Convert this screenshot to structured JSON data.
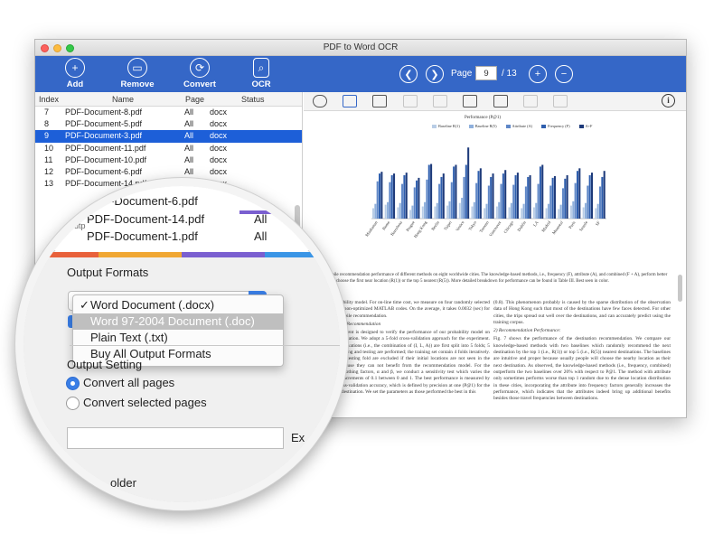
{
  "app": {
    "title": "PDF to Word OCR"
  },
  "toolbar": {
    "buttons": [
      {
        "label": "Add",
        "icon": "add-icon"
      },
      {
        "label": "Remove",
        "icon": "remove-icon"
      },
      {
        "label": "Convert",
        "icon": "convert-icon"
      },
      {
        "label": "OCR",
        "icon": "ocr-icon"
      }
    ],
    "nav": {
      "page_label": "Page",
      "current_page": "9",
      "total": "/ 13"
    }
  },
  "file_table": {
    "headers": [
      "Index",
      "Name",
      "Page",
      "Status"
    ],
    "rows": [
      {
        "index": "7",
        "name": "PDF-Document-8.pdf",
        "page": "All",
        "status": "docx"
      },
      {
        "index": "8",
        "name": "PDF-Document-5.pdf",
        "page": "All",
        "status": "docx"
      },
      {
        "index": "9",
        "name": "PDF-Document-3.pdf",
        "page": "All",
        "status": "docx"
      },
      {
        "index": "10",
        "name": "PDF-Document-11.pdf",
        "page": "All",
        "status": "docx"
      },
      {
        "index": "11",
        "name": "PDF-Document-10.pdf",
        "page": "All",
        "status": "docx"
      },
      {
        "index": "12",
        "name": "PDF-Document-6.pdf",
        "page": "All",
        "status": "docx"
      },
      {
        "index": "13",
        "name": "PDF-Document-14.pdf",
        "page": "All",
        "status": "docx"
      }
    ],
    "selected_index": "9"
  },
  "magnifier": {
    "rows": [
      {
        "name": "PDF-Document-6.pdf",
        "page": ""
      },
      {
        "name": "PDF-Document-14.pdf",
        "page": "All"
      },
      {
        "name": "PDF-Document-1.pdf",
        "page": "All"
      }
    ],
    "tab_fragment": "Outp",
    "output_formats_title": "Output Formats",
    "format_options": [
      {
        "label": "Word Document (.docx)",
        "checked": true
      },
      {
        "label": "Word 97-2004 Document (.doc)",
        "checked": false
      },
      {
        "label": "Plain Text (.txt)",
        "checked": false
      },
      {
        "label": "Buy All Output Formats",
        "checked": false
      }
    ],
    "output_setting_title": "Output Setting",
    "convert_all": "Convert all pages",
    "convert_selected": "Convert selected pages",
    "ex_fragment": "Ex",
    "folder_fragment": "older"
  },
  "document": {
    "chart_title": "Performance (P@1)",
    "legend": [
      "Baseline R(1)",
      "Baseline R(5)",
      "Attribute (A)",
      "Frequency (F)",
      "A+F"
    ],
    "figure_caption": "Fig. 7.   Mobile recommendation performance of different methods on eight worldwide cities. The knowledge-based methods, i.e., frequency (F), attribute (A), and combined (F + A), perform better than naively choose the first near location (R(1)) or the top 5 nearest (R(5)). More detailed breakdown for performance can be found in Table III. Best seen in color.",
    "col1_p1": "Bayesian probability model. For on-line time cost, we measure on four randomly selected cities using the non-optimized MATLAB codes. On the average, it takes 0.0032 (sec) for personalized mobile recommendation.",
    "col1_head": "A.  Mobile Travel Recommendation",
    "col1_p2": "The first experiment is designed to verify the performance of our probability model on travel recommendation. We adopt a 5-fold cross-validation approach for the experiment. That is, the observations (i.e., the combination of (I, L, A)) are first split into 5 folds; 5 iterations of training and testing are performed; the training set contain 4 folds iteratively. Instances in the testing fold are excluded if their initial locations are not seen in the training set because they can not benefit from the recommendation model. For the background smoothing factors, α and β, we conduct a sensitivity test which varies the parameters by increments of 0.1 between 0 and 1. The best performance is measured by the average cross-validation accuracy, which is defined by precision at one (P@1) for the recommended destination. We set the parameters as those performed the best in this",
    "col2_p1": "(0.8). This phenomenon probably is caused by the sparse distribution of the observation data of Hong Kong such that most of the destinations have few faces detected. For other cities, the trips spread out well over the destinations, and can accurately predict using the training corpus.",
    "col2_head": "2)  Recommendation Performance:",
    "col2_p2": "Fig. 7 shows the performance of the destination recommendation. We compare our knowledge-based methods with two baselines which randomly recommend the next destination by the top 1 (i.e., R(1)) or top 5 (i.e., R(5)) nearest destinations. The baselines are intuitive and proper because usually people will choose the nearby location as their next destination. As observed, the knowledge-based methods (i.e., frequency, combined) outperform the two baselines over 20% with respect to P@1. The method with attribute only sometimes performs worse than top 1 random due to the dense location distribution in these cities, incorporating the attribute into frequency factors generally increases the performance, which indicates that the attributes indeed bring up additional benefits besides those travel frequencies between destinations."
  },
  "chart_data": {
    "type": "bar",
    "title": "Performance (P@1)",
    "ylim": [
      0,
      1
    ],
    "categories": [
      "Manhattan",
      "Rome",
      "Barcelona",
      "Prague",
      "Hong Kong",
      "Berlin",
      "Taipei",
      "Venice",
      "Tokyo",
      "Toronto",
      "Vancouver",
      "Chicago",
      "Dublin",
      "LA",
      "Madrid",
      "Montreal",
      "Paris",
      "Seattle",
      "SF"
    ],
    "series": [
      {
        "name": "Baseline R(1)",
        "values": [
          0.12,
          0.16,
          0.13,
          0.1,
          0.14,
          0.14,
          0.15,
          0.18,
          0.14,
          0.12,
          0.14,
          0.13,
          0.12,
          0.13,
          0.12,
          0.11,
          0.15,
          0.13,
          0.12
        ]
      },
      {
        "name": "Baseline R(5)",
        "values": [
          0.17,
          0.19,
          0.18,
          0.15,
          0.19,
          0.18,
          0.2,
          0.24,
          0.19,
          0.17,
          0.19,
          0.18,
          0.17,
          0.18,
          0.17,
          0.16,
          0.2,
          0.18,
          0.17
        ]
      },
      {
        "name": "Attribute (A)",
        "values": [
          0.43,
          0.42,
          0.4,
          0.36,
          0.45,
          0.4,
          0.42,
          0.48,
          0.41,
          0.38,
          0.4,
          0.39,
          0.37,
          0.4,
          0.38,
          0.35,
          0.41,
          0.38,
          0.37
        ]
      },
      {
        "name": "Frequency (F)",
        "values": [
          0.52,
          0.5,
          0.5,
          0.44,
          0.62,
          0.48,
          0.6,
          0.62,
          0.55,
          0.48,
          0.52,
          0.5,
          0.48,
          0.6,
          0.47,
          0.46,
          0.55,
          0.5,
          0.48
        ]
      },
      {
        "name": "A+F",
        "values": [
          0.54,
          0.52,
          0.53,
          0.47,
          0.63,
          0.52,
          0.62,
          0.82,
          0.58,
          0.52,
          0.56,
          0.53,
          0.5,
          0.62,
          0.49,
          0.5,
          0.58,
          0.53,
          0.55
        ]
      }
    ],
    "colors": [
      "#b9cde6",
      "#8fb0dc",
      "#5f87c7",
      "#2f5fae",
      "#1d3a7a"
    ],
    "legend_position": "top"
  },
  "colors": {
    "toolbar": "#3567c7",
    "selection": "#1d5fd8",
    "accent": "#3a7ee6",
    "tab_strip": [
      "#e8613b",
      "#f0a733",
      "#7a5fd0",
      "#3a95e6"
    ]
  }
}
